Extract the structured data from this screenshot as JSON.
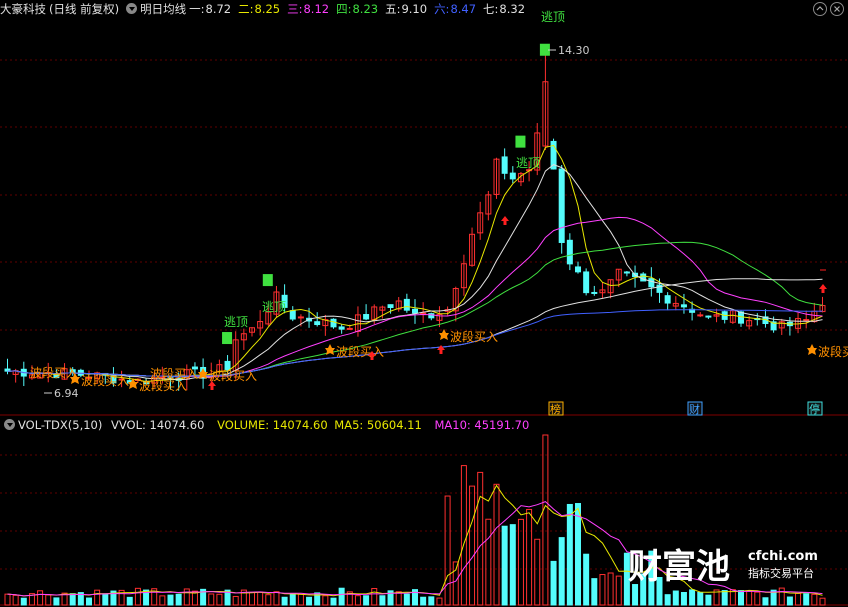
{
  "header": {
    "stock_name": "大豪科技",
    "period": "(日线 前复权)",
    "indicator": "明日均线",
    "ma_items": [
      {
        "label": "一:",
        "value": "8.72",
        "color": "#e0e0e0"
      },
      {
        "label": "二:",
        "value": "8.25",
        "color": "#e8e800"
      },
      {
        "label": "三:",
        "value": "8.12",
        "color": "#ff40ff"
      },
      {
        "label": "四:",
        "value": "8.23",
        "color": "#40e040"
      },
      {
        "label": "五:",
        "value": "9.10",
        "color": "#e0e0e0"
      },
      {
        "label": "六:",
        "value": "8.47",
        "color": "#4060ff"
      },
      {
        "label": "七:",
        "value": "8.32",
        "color": "#e0e0e0"
      }
    ]
  },
  "price_panel": {
    "high_label": "14.30",
    "low_label": "6.94",
    "escape_top_labels": [
      "逃顶",
      "逃顶",
      "逃顶",
      "逃顶"
    ],
    "band_buy_labels": [
      "波段买入",
      "波段买入",
      "波段买入",
      "波段买入",
      "波段买入",
      "波段买入",
      "波段买"
    ],
    "markers": [
      "榜",
      "财",
      "停"
    ]
  },
  "volume_header": {
    "name": "VOL-TDX(5,10)",
    "vvol": "VVOL: 14074.60",
    "volume": "VOLUME: 14074.60",
    "ma5": "MA5: 50604.11",
    "ma10": "MA10: 45191.70"
  },
  "watermark": {
    "brand": "财富池",
    "site": "cfchi.com",
    "slogan": "指标交易平台"
  },
  "colors": {
    "up": "#ff3030",
    "down": "#54fcfc",
    "ma5": "#e0e0e0",
    "volume_ma5": "#e8e800",
    "volume_ma10": "#ff40ff"
  }
}
